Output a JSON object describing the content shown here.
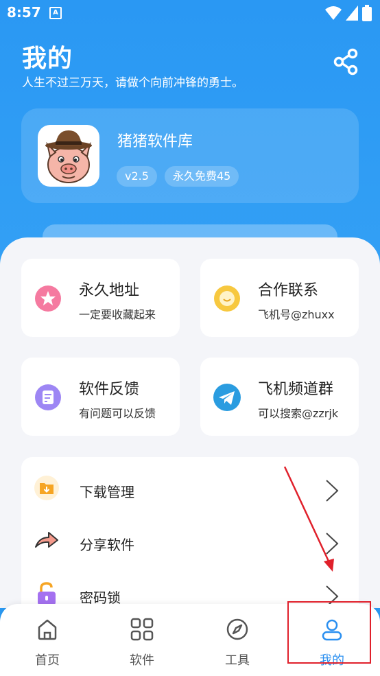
{
  "status_bar": {
    "time": "8:57",
    "notification_glyph": "A"
  },
  "header": {
    "title": "我的",
    "subtitle": "人生不过三万天，请做个向前冲锋的勇士。"
  },
  "app": {
    "name": "猪猪软件库",
    "version": "v2.5",
    "license": "永久免费45"
  },
  "cards": [
    {
      "label": "永久地址",
      "desc": "一定要收藏起来",
      "icon": "star-icon",
      "color": "#f06a8f"
    },
    {
      "label": "合作联系",
      "desc": "飞机号@zhuxx",
      "icon": "chat-bubble-icon",
      "color": "#f6c43c"
    },
    {
      "label": "软件反馈",
      "desc": "有问题可以反馈",
      "icon": "feedback-icon",
      "color": "#8b74f0"
    },
    {
      "label": "飞机频道群",
      "desc": "可以搜索@zzrjk",
      "icon": "telegram-icon",
      "color": "#2a9ce0"
    }
  ],
  "list": [
    {
      "label": "下载管理",
      "icon": "download-folder-icon"
    },
    {
      "label": "分享软件",
      "icon": "share-arrow-icon"
    },
    {
      "label": "密码锁",
      "icon": "lock-icon"
    }
  ],
  "nav": [
    {
      "label": "首页",
      "icon": "home-icon"
    },
    {
      "label": "软件",
      "icon": "grid-icon"
    },
    {
      "label": "工具",
      "icon": "compass-icon"
    },
    {
      "label": "我的",
      "icon": "user-icon",
      "active": true
    }
  ],
  "colors": {
    "primary": "#2a98f3",
    "accent_active": "#2a8ff0",
    "annotation_red": "#e0202b"
  }
}
